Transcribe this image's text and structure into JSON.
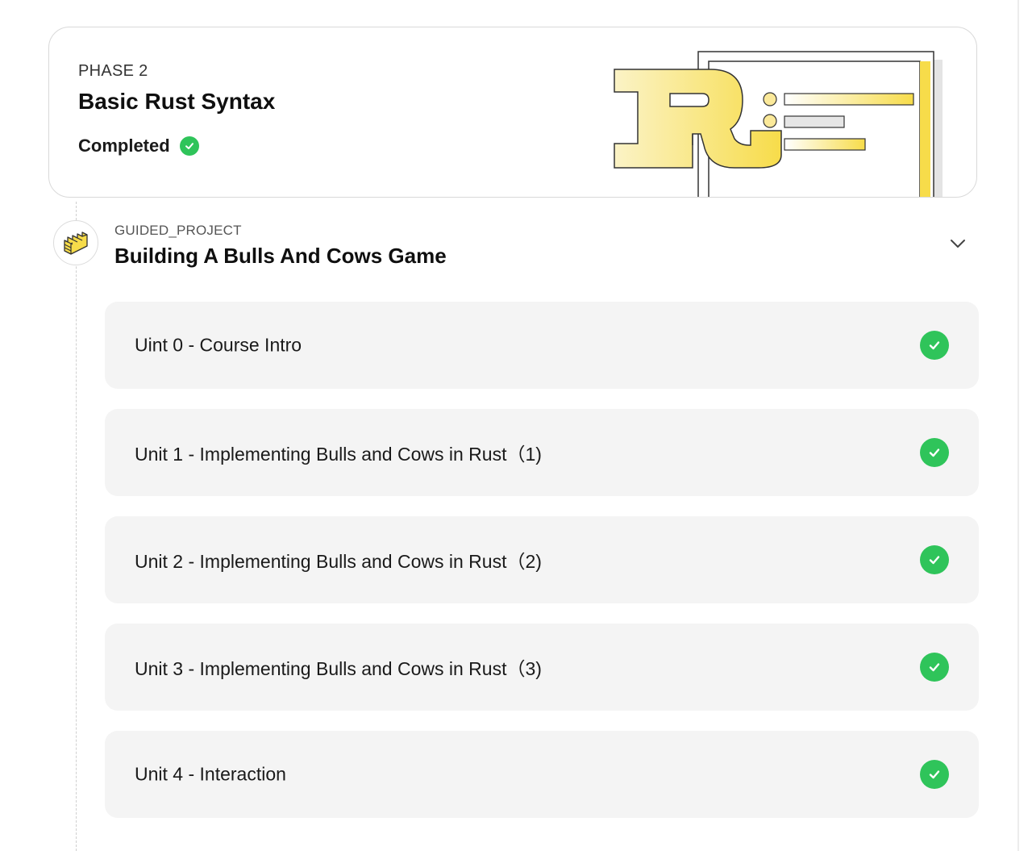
{
  "phase": {
    "label": "PHASE 2",
    "title": "Basic Rust Syntax",
    "status": "Completed"
  },
  "project": {
    "type": "GUIDED_PROJECT",
    "title": "Building A Bulls And Cows Game"
  },
  "units": [
    {
      "label": "Uint 0 - Course Intro",
      "completed": true
    },
    {
      "label": "Unit 1 - Implementing Bulls and Cows in Rust（1)",
      "completed": true
    },
    {
      "label": "Unit 2 - Implementing Bulls and Cows in Rust（2)",
      "completed": true
    },
    {
      "label": "Unit 3 - Implementing Bulls and Cows in Rust（3)",
      "completed": true
    },
    {
      "label": "Unit 4 - Interaction",
      "completed": true
    }
  ],
  "icons": {
    "status": "check-circle-icon",
    "project": "stairs-icon",
    "toggle": "chevron-down-icon",
    "illustration": "rust-r-illustration"
  },
  "colors": {
    "success": "#2fc45a",
    "accent": "#f7dc4a"
  }
}
